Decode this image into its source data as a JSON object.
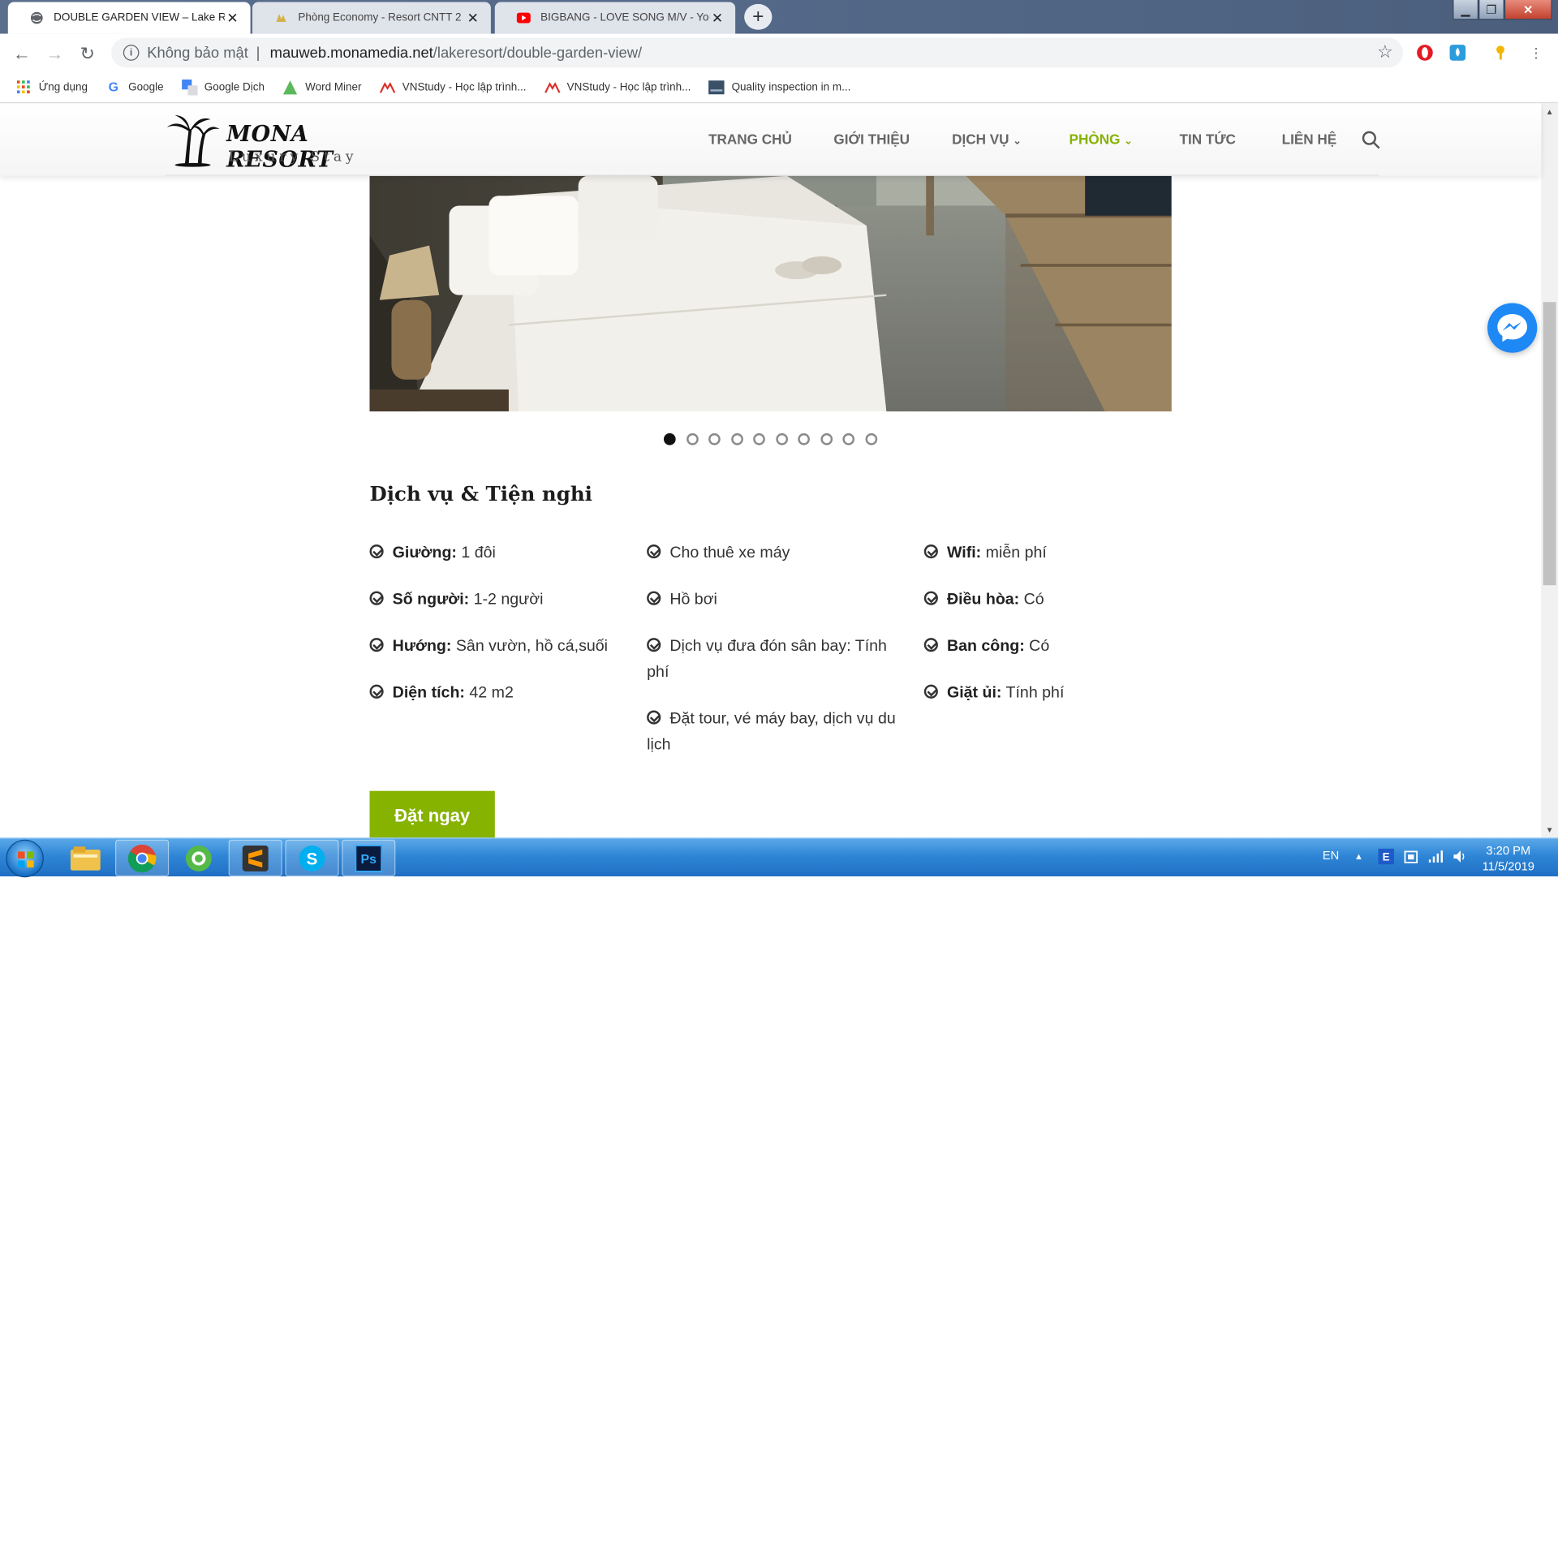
{
  "browser": {
    "tabs": [
      {
        "title": "DOUBLE GARDEN VIEW – Lake Resort",
        "active": true,
        "favicon": "globe-icon"
      },
      {
        "title": "Phòng Economy - Resort CNTT 2",
        "active": false,
        "favicon": "site-icon"
      },
      {
        "title": "BIGBANG - LOVE SONG M/V - YouTube",
        "active": false,
        "favicon": "youtube-icon"
      }
    ],
    "new_tab": "+",
    "window_controls": {
      "minimize": "▁",
      "maximize": "❐",
      "close": "✕"
    },
    "omnibox": {
      "security_label": "Không bảo mật",
      "separator": "|",
      "host": "mauweb.monamedia.net",
      "path": "/lakeresort/double-garden-view/"
    },
    "bookmarks": [
      {
        "label": "Ứng dụng",
        "icon": "apps-grid-icon"
      },
      {
        "label": "Google",
        "icon": "google-icon"
      },
      {
        "label": "Google Dịch",
        "icon": "translate-icon"
      },
      {
        "label": "Word Miner",
        "icon": "wordminer-icon"
      },
      {
        "label": "VNStudy - Học lập trình...",
        "icon": "vnstudy-icon"
      },
      {
        "label": "VNStudy - Học lập trình...",
        "icon": "vnstudy-icon"
      },
      {
        "label": "Quality inspection in m...",
        "icon": "doc-icon"
      }
    ]
  },
  "site": {
    "logo": {
      "name": "MONA RESORT",
      "tagline": "Luxury Stay"
    },
    "nav": [
      "TRANG CHỦ",
      "GIỚI THIỆU",
      "DỊCH VỤ",
      "PHÒNG",
      "TIN TỨC",
      "LIÊN HỆ"
    ],
    "active_nav": "PHÒNG",
    "slider": {
      "slide_count": 10,
      "active_index": 0
    },
    "amenities_title": "Dịch vụ & Tiện nghi",
    "amenities": {
      "col1": [
        {
          "label": "Giường:",
          "value": "1 đôi"
        },
        {
          "label": "Số người:",
          "value": "1-2 người"
        },
        {
          "label": "Hướng:",
          "value": "Sân vườn, hồ cá,suối"
        },
        {
          "label": "Diện tích:",
          "value": "42 m2"
        }
      ],
      "col2": [
        {
          "label": "",
          "value": "Cho thuê xe máy"
        },
        {
          "label": "",
          "value": "Hồ bơi"
        },
        {
          "label": "",
          "value": "Dịch vụ đưa đón sân bay: Tính phí"
        },
        {
          "label": "",
          "value": "Đặt tour, vé máy bay, dịch vụ du lịch"
        }
      ],
      "col3": [
        {
          "label": "Wifi:",
          "value": "miễn phí"
        },
        {
          "label": "Điều hòa:",
          "value": "Có"
        },
        {
          "label": "Ban công:",
          "value": "Có"
        },
        {
          "label": "Giặt ủi:",
          "value": "Tính phí"
        }
      ]
    },
    "book_button": "Đặt ngay",
    "accent_color": "#86b200"
  },
  "taskbar": {
    "apps": [
      "explorer-icon",
      "chrome-icon",
      "coccoc-icon",
      "sublime-icon",
      "skype-icon",
      "photoshop-icon"
    ],
    "language": "EN",
    "time": "3:20 PM",
    "date": "11/5/2019"
  }
}
